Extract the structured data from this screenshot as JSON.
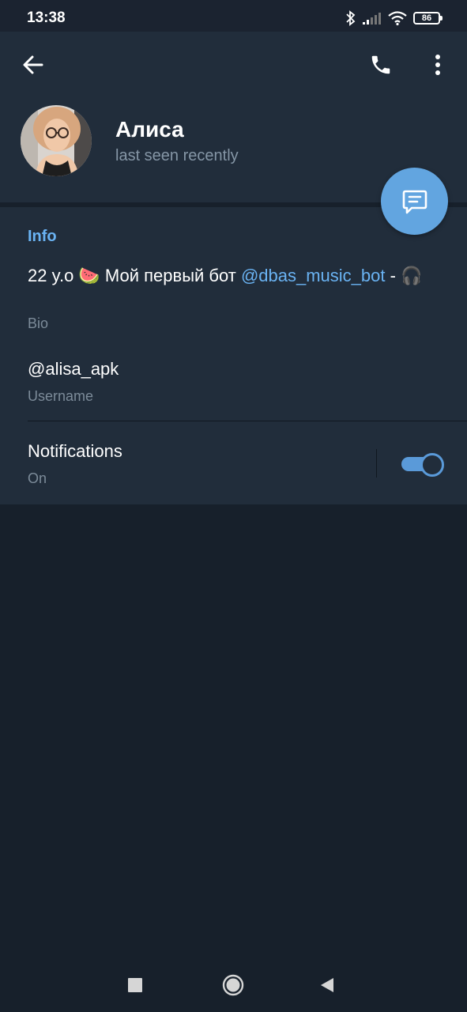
{
  "status_bar": {
    "time": "13:38",
    "battery": "86"
  },
  "profile": {
    "name": "Алиса",
    "status": "last seen recently"
  },
  "info": {
    "section_title": "Info",
    "bio_text": "22 y.o 🍉 Мой первый бот ",
    "bio_link": "@dbas_music_bot",
    "bio_suffix": " - 🎧",
    "bio_label": "Bio",
    "username": "@alisa_apk",
    "username_label": "Username",
    "notifications_title": "Notifications",
    "notifications_value": "On",
    "notifications_enabled": true
  },
  "icons": {
    "back": "arrow-back",
    "call": "phone",
    "more": "more-vertical",
    "fab": "message-bubble"
  },
  "colors": {
    "background": "#17202b",
    "card": "#212d3b",
    "accent": "#6ab3f3",
    "fab": "#62a5e0"
  }
}
